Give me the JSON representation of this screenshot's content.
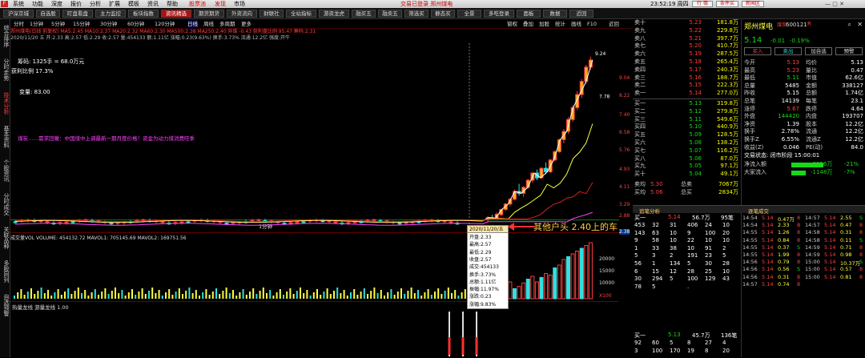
{
  "menubar": {
    "items": [
      "系统",
      "功能",
      "深度",
      "报价",
      "分析",
      "扩展",
      "模板",
      "资讯",
      "帮助"
    ],
    "app_mode": "股票池",
    "status1": "发现",
    "status2": "市场",
    "center": "交易已登录  郑州煤电",
    "time": "23:52:19 周四",
    "buttons": [
      "行 情",
      "条件买",
      "新闻区"
    ]
  },
  "toolbar": [
    "沪深京城",
    "自选股",
    "盯盘看盘",
    "主力监控",
    "板块指数",
    "资讯精选",
    "期货期货",
    "外资流向",
    "财联社",
    "全站指标",
    "游资龙虎",
    "融买五",
    "融卖五",
    "筛选买",
    "静态买",
    "全景",
    "多吃登录",
    "面板",
    "数据",
    "近回"
  ],
  "toolbar_active": 5,
  "sidebar": [
    "综合排序",
    "分时走势",
    "技术分析",
    "基本资料",
    "个股资讯",
    "分时成交",
    "关联品种",
    "多股同列",
    "自选预警"
  ],
  "sidebar_active": 2,
  "periodbar": {
    "items": [
      "分时",
      "1分钟",
      "5分钟",
      "15分钟",
      "30分钟",
      "60分钟",
      "120分钟",
      "日线",
      "周线",
      "多周期",
      "更多"
    ],
    "active": 7,
    "right": [
      "窗权",
      "叠加",
      "加股",
      "统计",
      "画线",
      "F10",
      "近回"
    ]
  },
  "chart_title": {
    "line1": "郑州煤电(日线 前复权)  MA5:2.45  MA10:2.37  MA20:2.32  MA60:2.30  MA500:2.38  MA250:2.40  异维 -0.43  获利盘比例 95.47  筹码:2.31",
    "line2": "2020/11/20 五  开:2.33  高:2.57  低:2.29  收:2.57  量:454133  额:1.11亿  涨幅:0.23(9.63%)  换手:3.73%  流通:12.2亿  强度:开牛",
    "float_label": "筹码: 1325手 = 68.0万元",
    "profit_label": "获利比例 17.3%",
    "info_label": "变量: 83.00",
    "news_label": "煤炭……需求回暖：中国煤中上调最新一期月度价格！资金为动力煤消费旺季",
    "axis_x_label": "1分钟"
  },
  "price_axis": [
    "9.04",
    "8.22",
    "7.40",
    "6.58",
    "5.76",
    "4.93",
    "4.11",
    "3.29",
    "2.88",
    "2.38"
  ],
  "chart_data": [
    {
      "type": "candlestick",
      "title": "郑州煤电(日线 前复权)",
      "series": [
        {
          "name": "MA5",
          "color": "#ffffff"
        },
        {
          "name": "MA10",
          "color": "#ffff40"
        },
        {
          "name": "MA20",
          "color": "#ff40ff"
        },
        {
          "name": "MA60",
          "color": "#30ff30"
        }
      ],
      "ohlc": [
        [
          2.4,
          2.55,
          2.3,
          2.48
        ],
        [
          2.48,
          2.6,
          2.42,
          2.45
        ],
        [
          2.45,
          2.7,
          2.4,
          2.62
        ],
        [
          2.6,
          2.85,
          2.55,
          2.82
        ],
        [
          2.82,
          3.1,
          2.75,
          3.05
        ],
        [
          3.05,
          3.3,
          2.95,
          3.25
        ],
        [
          3.25,
          3.65,
          3.2,
          3.58
        ],
        [
          3.58,
          3.9,
          3.4,
          3.5
        ],
        [
          3.5,
          3.8,
          3.35,
          3.75
        ],
        [
          3.75,
          4.1,
          3.7,
          4.05
        ],
        [
          4.05,
          4.4,
          3.95,
          4.35
        ],
        [
          4.35,
          4.5,
          4.05,
          4.15
        ],
        [
          4.15,
          4.6,
          4.1,
          4.55
        ],
        [
          4.55,
          4.8,
          4.3,
          4.4
        ],
        [
          4.4,
          4.95,
          4.35,
          4.9
        ],
        [
          4.9,
          5.3,
          4.85,
          5.25
        ],
        [
          5.25,
          5.8,
          5.2,
          5.75
        ],
        [
          5.75,
          6.2,
          5.6,
          6.1
        ],
        [
          6.1,
          6.7,
          6.0,
          6.6
        ],
        [
          6.6,
          7.2,
          6.5,
          7.1
        ],
        [
          7.1,
          7.8,
          7.0,
          7.65
        ],
        [
          7.65,
          8.3,
          7.5,
          8.2
        ],
        [
          8.2,
          8.9,
          8.1,
          8.8
        ],
        [
          8.8,
          9.24,
          8.7,
          9.1
        ]
      ],
      "labels": [
        "9.24",
        "7.78"
      ],
      "ylim": [
        2.2,
        9.4
      ]
    },
    {
      "type": "bar",
      "title": "成交量VOL",
      "values": [
        12,
        15,
        9,
        20,
        25,
        30,
        18,
        22,
        28,
        35,
        40,
        30,
        38,
        45,
        42,
        55,
        60,
        70,
        75,
        80,
        85,
        90,
        95,
        100
      ],
      "header": "成交量VOL VOLUME: 454132.72  MAVOL1: 705145.69  MAVOL2: 169751.56",
      "axis": [
        "20000",
        "15000",
        "10000"
      ],
      "unit": "X100"
    }
  ],
  "ind3_label": "热量龙线  游量龙线 1.00",
  "popup": {
    "title": "2020/11/20/五",
    "lines": [
      "开盘:2.33",
      "最高:2.57",
      "最低:2.29",
      "收盘:2.57",
      "成交:454133",
      "换手:3.73%",
      "总额:1.11亿",
      "振幅:11.97%",
      "涨跌:0.23",
      "涨幅:9.83%"
    ]
  },
  "annotation": "其他户头 2.40上的车",
  "quote": {
    "sell": [
      [
        "卖十",
        "5.23",
        "181.8万"
      ],
      [
        "卖九",
        "5.22",
        "229.8万"
      ],
      [
        "卖八",
        "5.21",
        "397.7万"
      ],
      [
        "卖七",
        "5.20",
        "410.7万"
      ],
      [
        "卖六",
        "5.19",
        "287.5万"
      ],
      [
        "卖五",
        "5.18",
        "265.4万"
      ],
      [
        "卖四",
        "5.17",
        "240.3万"
      ],
      [
        "卖三",
        "5.16",
        "188.7万"
      ],
      [
        "卖二",
        "5.15",
        "222.3万"
      ],
      [
        "卖一",
        "5.14",
        "277.0万"
      ]
    ],
    "buy": [
      [
        "买一",
        "5.13",
        "319.8万"
      ],
      [
        "买二",
        "5.12",
        "279.8万"
      ],
      [
        "买三",
        "5.11",
        "549.6万"
      ],
      [
        "买四",
        "5.10",
        "440.9万"
      ],
      [
        "买五",
        "5.09",
        "128.5万"
      ],
      [
        "买六",
        "5.08",
        "138.2万"
      ],
      [
        "买七",
        "5.07",
        "116.2万"
      ],
      [
        "买八",
        "5.06",
        "87.0万"
      ],
      [
        "买九",
        "5.05",
        "97.1万"
      ],
      [
        "买十",
        "5.04",
        "49.1万"
      ]
    ],
    "totals": [
      [
        "卖均",
        "5.30",
        "总卖",
        "7067万"
      ],
      [
        "买均",
        "5.06",
        "总买",
        "2834万"
      ]
    ]
  },
  "stock": {
    "name": "郑州煤电",
    "tag": "煤炭",
    "code": "600121",
    "price": "5.14",
    "change": "-0.01",
    "pct": "-0.19%",
    "buttons": [
      "买入",
      "卖出",
      "加自选",
      "预警"
    ],
    "fields": [
      [
        "今开",
        "5.13",
        "均价",
        "5.13"
      ],
      [
        "最高",
        "5.23",
        "量比",
        "0.47"
      ],
      [
        "最低",
        "5.11",
        "市值",
        "62.6亿"
      ],
      [
        "总量",
        "5485",
        "金额",
        "338127"
      ],
      [
        "昨收",
        "5.15",
        "总额",
        "1.74亿"
      ],
      [
        "总笔",
        "14139",
        "每笔",
        "23.1"
      ],
      [
        "涨停",
        "5.67",
        "跌停",
        "4.64"
      ],
      [
        "外盘",
        "144420",
        "内盘",
        "193707"
      ],
      [
        "净资",
        "1.39",
        "股本",
        "12.2亿"
      ],
      [
        "换手",
        "2.78%",
        "流通",
        "12.2亿"
      ],
      [
        "换手Z",
        "6.55%",
        "流通Z",
        "12.2亿"
      ],
      [
        "收益(Z)",
        "0.046",
        "PE(动)",
        "84.0"
      ]
    ],
    "trade_status": "交易状态: 闭市阶段 15:00:01",
    "net_inflow_label": "净流入额",
    "net_inflow": "-3616万",
    "net_inflow_pct": "-21%",
    "big_label": "大家流入",
    "big": "-1148万",
    "big_pct": "-7%"
  },
  "analysis": {
    "title": "追笔分析",
    "header": [
      "买一",
      "5.14",
      "56.7万",
      "95笔"
    ],
    "rows": [
      [
        "453",
        "32",
        "31",
        "406",
        "24",
        "10"
      ],
      [
        "143",
        "63",
        "10",
        "9",
        "100",
        "20"
      ],
      [
        "9",
        "58",
        "10",
        "22",
        "10",
        "10"
      ],
      [
        "1",
        "33",
        "38",
        "10",
        "91",
        "2"
      ],
      [
        "5",
        "3",
        "2",
        "191",
        "23",
        "5"
      ],
      [
        "56",
        "1",
        "134",
        "5",
        "30",
        "28"
      ],
      [
        "6",
        "15",
        "12",
        "28",
        "25",
        "10"
      ],
      [
        "30",
        "294",
        "5",
        "100",
        "129",
        "43"
      ],
      [
        "78",
        "5",
        "",
        ".",
        "",
        ""
      ]
    ],
    "footer": [
      "买一",
      "5.13",
      "45.7万",
      "136笔"
    ],
    "footer_rows": [
      [
        "92",
        "60",
        "5",
        "8",
        "27",
        "4"
      ],
      [
        "3",
        "100",
        "170",
        "19",
        "8",
        "20"
      ]
    ]
  },
  "ticks": {
    "title": "逐笔成交",
    "rows": [
      [
        "14:54",
        "5.14",
        "0.47万",
        "8"
      ],
      [
        "14:54",
        "5.14",
        "2.33",
        "B"
      ],
      [
        "14:55",
        "5.14",
        "1.26",
        "8"
      ],
      [
        "14:55",
        "5.14",
        "0.84",
        "8"
      ],
      [
        "14:55",
        "5.14",
        "0.37",
        "S"
      ],
      [
        "14:55",
        "5.14",
        "1.99",
        "8"
      ],
      [
        "14:56",
        "5.14",
        "0.79",
        "8"
      ],
      [
        "14:56",
        "5.14",
        "0.56",
        "S"
      ],
      [
        "14:56",
        "5.14",
        "0.31",
        "8"
      ],
      [
        "14:57",
        "5.14",
        "0.74",
        "8"
      ],
      [
        "14:57",
        "5.14",
        "2.55",
        "S"
      ],
      [
        "14:57",
        "5.14",
        "0.47",
        "8"
      ],
      [
        "14:58",
        "5.14",
        "0.31",
        "8"
      ],
      [
        "14:58",
        "5.14",
        "0.11",
        "S"
      ],
      [
        "14:59",
        "5.14",
        "0.71",
        "8"
      ],
      [
        "14:59",
        "5.14",
        "0.98",
        "8"
      ],
      [
        "15:00",
        "5.14",
        "10.37万",
        "S"
      ],
      [
        "15:00",
        "5.14",
        "0.57",
        "8"
      ],
      [
        "15:00",
        "5.14",
        "0.81",
        "8"
      ]
    ]
  },
  "colors": {
    "up": "#ff3c3c",
    "down": "#30e0e0",
    "ma5": "#ffffff",
    "ma10": "#ffff40",
    "ma20": "#ff40ff",
    "ma60": "#30ff30",
    "ma_long": "#d02020"
  }
}
